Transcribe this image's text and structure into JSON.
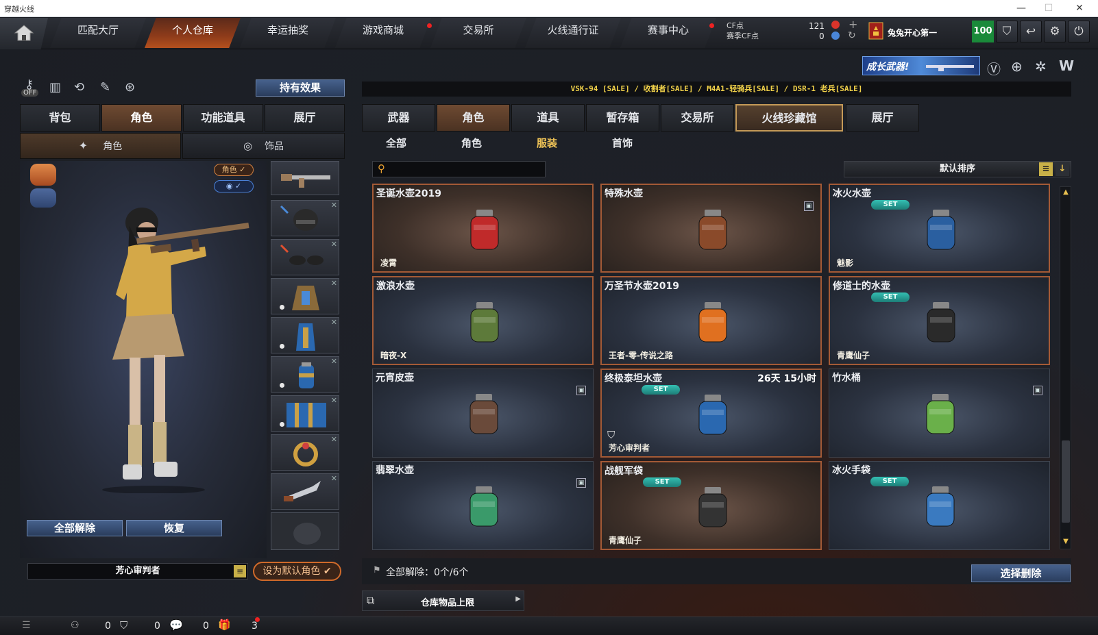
{
  "window": {
    "title": "穿越火线"
  },
  "nav": {
    "tabs": [
      {
        "label": "匹配大厅"
      },
      {
        "label": "个人仓库"
      },
      {
        "label": "幸运抽奖"
      },
      {
        "label": "游戏商城"
      },
      {
        "label": "交易所"
      },
      {
        "label": "火线通行证"
      },
      {
        "label": "赛事中心"
      }
    ],
    "active_index": 1,
    "cf_label": "CF点",
    "match_cf_label": "赛季CF点",
    "cf_value": "121",
    "match_cf_value": "0",
    "username": "兔兔开心第一",
    "level": "100"
  },
  "banner": {
    "text": "成长武器!"
  },
  "left": {
    "hold_effect_label": "持有效果",
    "tabs": [
      {
        "label": "背包"
      },
      {
        "label": "角色"
      },
      {
        "label": "功能道具"
      },
      {
        "label": "展厅"
      }
    ],
    "subtabs": [
      {
        "label": "角色"
      },
      {
        "label": "饰品"
      }
    ],
    "tag_role": "角色 ✓",
    "tag_eye": "✓",
    "release_all_label": "全部解除",
    "restore_label": "恢复",
    "character_name": "芳心审判者",
    "set_default_label": "设为默认角色"
  },
  "right": {
    "ticker": "VSK-94  [SALE] / 收割者[SALE] / M4A1-轻骑兵[SALE] / DSR-1 老兵[SALE]",
    "tabs": [
      {
        "label": "武器"
      },
      {
        "label": "角色"
      },
      {
        "label": "道具"
      },
      {
        "label": "暂存箱"
      },
      {
        "label": "交易所"
      },
      {
        "label": "火线珍藏馆"
      },
      {
        "label": "展厅"
      }
    ],
    "filters": [
      {
        "label": "全部"
      },
      {
        "label": "角色"
      },
      {
        "label": "服装"
      },
      {
        "label": "首饰"
      }
    ],
    "search_placeholder": "",
    "sort_label": "默认排序",
    "items": [
      {
        "name": "圣诞水壶2019",
        "owner": "凌霄",
        "set": "",
        "time": "",
        "color": "#c02a2a"
      },
      {
        "name": "特殊水壶",
        "owner": "",
        "set": "",
        "time": "",
        "color": "#8a4a2a"
      },
      {
        "name": "冰火水壶",
        "owner": "魅影",
        "set": "SET",
        "time": "",
        "color": "#2a5fa0"
      },
      {
        "name": "激浪水壶",
        "owner": "暗夜-X",
        "set": "",
        "time": "",
        "color": "#5d7a3a"
      },
      {
        "name": "万圣节水壶2019",
        "owner": "王者-零-传说之路",
        "set": "",
        "time": "",
        "color": "#e07020"
      },
      {
        "name": "修道士的水壶",
        "owner": "青鹰仙子",
        "set": "SET",
        "time": "",
        "color": "#2a2a2a"
      },
      {
        "name": "元宵皮壶",
        "owner": "",
        "set": "",
        "time": "",
        "color": "#6a4a3a"
      },
      {
        "name": "终极泰坦水壶",
        "owner": "芳心审判者",
        "set": "SET",
        "time": "26天 15小时",
        "color": "#2a68b0"
      },
      {
        "name": "竹水桶",
        "owner": "",
        "set": "",
        "time": "",
        "color": "#6ab04a"
      },
      {
        "name": "翡翠水壶",
        "owner": "",
        "set": "",
        "time": "",
        "color": "#3a9a6a"
      },
      {
        "name": "战舰军袋",
        "owner": "青鹰仙子",
        "set": "SET",
        "time": "",
        "color": "#333333"
      },
      {
        "name": "冰火手袋",
        "owner": "",
        "set": "SET",
        "time": "",
        "color": "#3a7ac0"
      }
    ],
    "release_all": "全部解除：0个/6个",
    "select_delete_label": "选择删除",
    "storage_limit_label": "仓库物品上限"
  },
  "bottom": {
    "counts": [
      "0",
      "0",
      "0",
      "3"
    ]
  }
}
